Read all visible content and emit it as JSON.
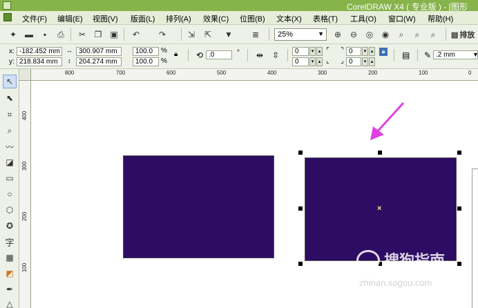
{
  "titlebar": {
    "title": "CorelDRAW X4 ( 专业版 ) - [图形"
  },
  "menu": [
    "文件(F)",
    "编辑(E)",
    "视图(V)",
    "版面(L)",
    "排列(A)",
    "效果(C)",
    "位图(B)",
    "文本(X)",
    "表格(T)",
    "工具(O)",
    "窗口(W)",
    "帮助(H)"
  ],
  "toolbar": {
    "zoom": "25%",
    "arrange_label": "排放"
  },
  "props": {
    "x_label": "x:",
    "x_value": "-182.452 mm",
    "y_label": "y:",
    "y_value": "218.834 mm",
    "w_value": "300.907 mm",
    "h_value": "204.274 mm",
    "scale_w": "100.0",
    "scale_h": "100.0",
    "percent": "%",
    "angle": ".0",
    "degree": "°",
    "corner_a": "0",
    "corner_b": "0",
    "corner_c": "0",
    "corner_d": "0",
    "outline": ".2 mm"
  },
  "ruler_h": [
    "800",
    "700",
    "600",
    "500",
    "400",
    "300",
    "200",
    "100",
    "0"
  ],
  "ruler_v": [
    "400",
    "300",
    "200",
    "100"
  ],
  "tools": [
    "pick-tool",
    "shape-tool",
    "crop-tool",
    "zoom-tool",
    "freehand-tool",
    "smart-fill-tool",
    "rectangle-tool",
    "ellipse-tool",
    "polygon-tool",
    "basic-shapes-tool",
    "text-tool",
    "table-tool",
    "interactive-tool",
    "eyedropper-tool",
    "outline-tool"
  ],
  "text_tool_glyph": "字",
  "colors": {
    "fill": "#2d0c63",
    "arrow": "#e040e0"
  },
  "watermark": {
    "main": "搜狗指南",
    "sub": "zhinan.sogou.com"
  }
}
